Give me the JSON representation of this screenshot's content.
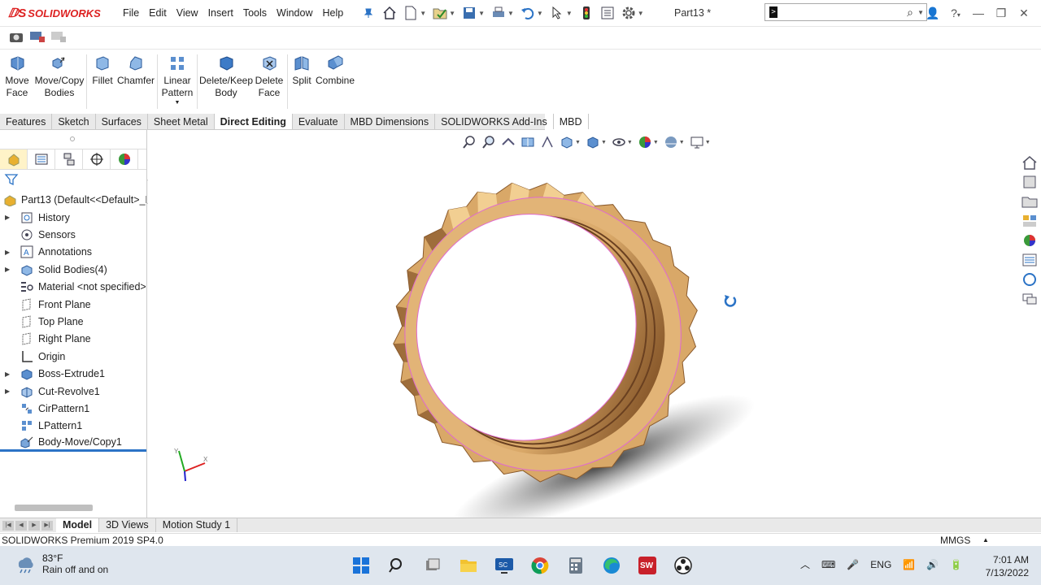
{
  "app": {
    "brand": "SOLIDWORKS",
    "doc_title": "Part13 *"
  },
  "menu": [
    "File",
    "Edit",
    "View",
    "Insert",
    "Tools",
    "Window",
    "Help"
  ],
  "ribbon": {
    "buttons": [
      {
        "label": "Move\nFace",
        "l1": "Move",
        "l2": "Face"
      },
      {
        "l1": "Move/Copy",
        "l2": "Bodies"
      },
      {
        "l1": "Fillet",
        "l2": ""
      },
      {
        "l1": "Chamfer",
        "l2": ""
      },
      {
        "l1": "Linear",
        "l2": "Pattern"
      },
      {
        "l1": "Delete/Keep",
        "l2": "Body"
      },
      {
        "l1": "Delete",
        "l2": "Face"
      },
      {
        "l1": "Split",
        "l2": ""
      },
      {
        "l1": "Combine",
        "l2": ""
      }
    ]
  },
  "tabs": [
    "Features",
    "Sketch",
    "Surfaces",
    "Sheet Metal",
    "Direct Editing",
    "Evaluate",
    "MBD Dimensions",
    "SOLIDWORKS Add-Ins",
    "MBD"
  ],
  "active_tab": "Direct Editing",
  "tree": {
    "root": "Part13  (Default<<Default>_D",
    "items": [
      {
        "label": "History",
        "expand": true
      },
      {
        "label": "Sensors",
        "expand": false
      },
      {
        "label": "Annotations",
        "expand": true
      },
      {
        "label": "Solid Bodies(4)",
        "expand": true
      },
      {
        "label": "Material <not specified>",
        "expand": false
      },
      {
        "label": "Front Plane",
        "expand": false
      },
      {
        "label": "Top Plane",
        "expand": false
      },
      {
        "label": "Right Plane",
        "expand": false
      },
      {
        "label": "Origin",
        "expand": false
      },
      {
        "label": "Boss-Extrude1",
        "expand": true
      },
      {
        "label": "Cut-Revolve1",
        "expand": true
      },
      {
        "label": "CirPattern1",
        "expand": false
      },
      {
        "label": "LPattern1",
        "expand": false
      },
      {
        "label": "Body-Move/Copy1",
        "expand": false
      }
    ]
  },
  "bottom_tabs": [
    "Model",
    "3D Views",
    "Motion Study 1"
  ],
  "status": {
    "left": "SOLIDWORKS Premium 2019 SP4.0",
    "units": "MMGS"
  },
  "taskbar": {
    "temp": "83°F",
    "weather": "Rain off and on",
    "lang": "ENG",
    "time": "7:01 AM",
    "date": "7/13/2022"
  },
  "colors": {
    "ring_main": "#d9a868",
    "ring_dark": "#8a5a2c",
    "ring_light": "#f2cf92",
    "accent_blue": "#2b73c6",
    "edge_pink": "#e06ad0"
  }
}
